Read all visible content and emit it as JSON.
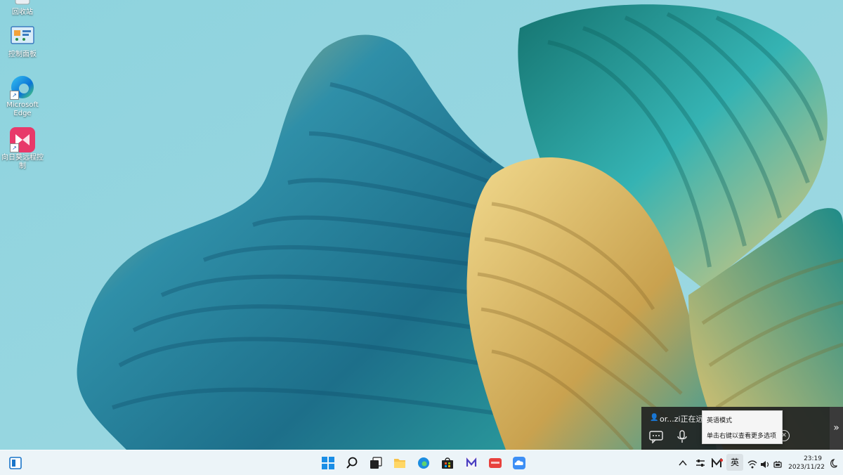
{
  "desktop": {
    "icons": [
      {
        "label": "回收站"
      },
      {
        "label": "控制面板"
      },
      {
        "label": "Microsoft Edge"
      },
      {
        "label": "向日葵远程控制"
      }
    ]
  },
  "remote_panel": {
    "status": "or...zi正在远程"
  },
  "ime_tooltip": {
    "title": "英语模式",
    "hint": "单击右键以查看更多选项"
  },
  "tray": {
    "ime_label": "英",
    "time": "23:19",
    "date": "2023/11/22"
  },
  "colors": {
    "taskbar_bg": "#f3f6fa",
    "accent": "#0067c0",
    "wallpaper_bg": "#8fd0dc",
    "petal_teal": "#1f8c8f",
    "petal_gold": "#d9bb68"
  }
}
